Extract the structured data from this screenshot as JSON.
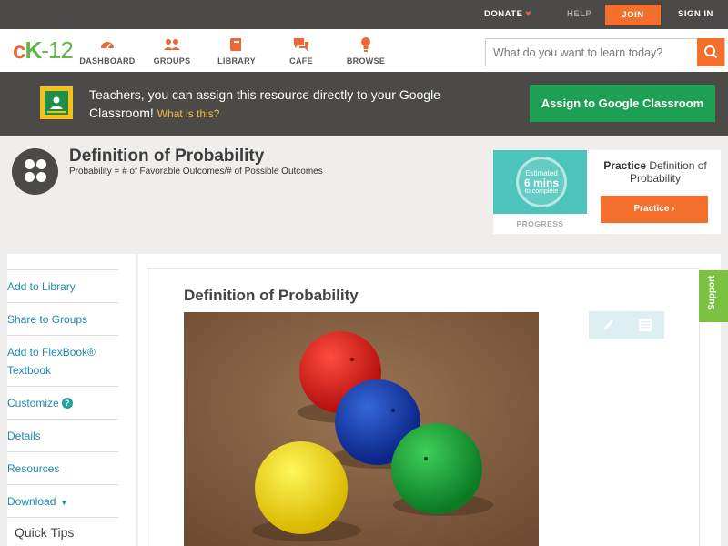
{
  "topbar": {
    "donate": "DONATE",
    "help": "HELP",
    "join": "JOIN",
    "signin": "SIGN IN"
  },
  "logo": {
    "part_c": "c",
    "part_k": "K",
    "part_rest": "-12"
  },
  "nav": {
    "items": [
      {
        "label": "DASHBOARD",
        "icon": "dashboard-gauge-icon"
      },
      {
        "label": "GROUPS",
        "icon": "groups-people-icon"
      },
      {
        "label": "LIBRARY",
        "icon": "library-book-icon"
      },
      {
        "label": "CAFE",
        "icon": "cafe-chat-icon"
      },
      {
        "label": "BROWSE",
        "icon": "browse-lightbulb-icon"
      }
    ],
    "search_placeholder": "What do you want to learn today?"
  },
  "banner": {
    "text": "Teachers, you can assign this resource directly to your Google Classroom!",
    "what_is_this": "What is this?",
    "assign_button": "Assign to Google Classroom"
  },
  "concept": {
    "title": "Definition of Probability",
    "subtitle": "Probability = # of Favorable Outcomes/# of Possible Outcomes"
  },
  "practice_card": {
    "estimated": "Estimated",
    "mins": "6 mins",
    "to_complete": "to complete",
    "progress_label": "PROGRESS",
    "title_bold": "Practice",
    "title_rest": " Definition of Probability",
    "button": "Practice"
  },
  "sidebar": {
    "items": [
      {
        "label": "Add to Library"
      },
      {
        "label": "Share to Groups"
      },
      {
        "label": "Add to FlexBook® Textbook"
      },
      {
        "label": "Customize"
      },
      {
        "label": "Details"
      },
      {
        "label": "Resources"
      },
      {
        "label": "Download"
      }
    ],
    "quick_tips": "Quick Tips"
  },
  "main": {
    "title": "Definition of Probability",
    "image_alt": "four colored balls: red, blue, yellow, green on carpet"
  },
  "support_tab": "Support",
  "colors": {
    "accent_orange": "#f36f2b",
    "link_blue": "#1a8ab3",
    "assign_green": "#1d9f54",
    "support_green": "#7cc242",
    "dark_bar": "#4b4a47"
  }
}
